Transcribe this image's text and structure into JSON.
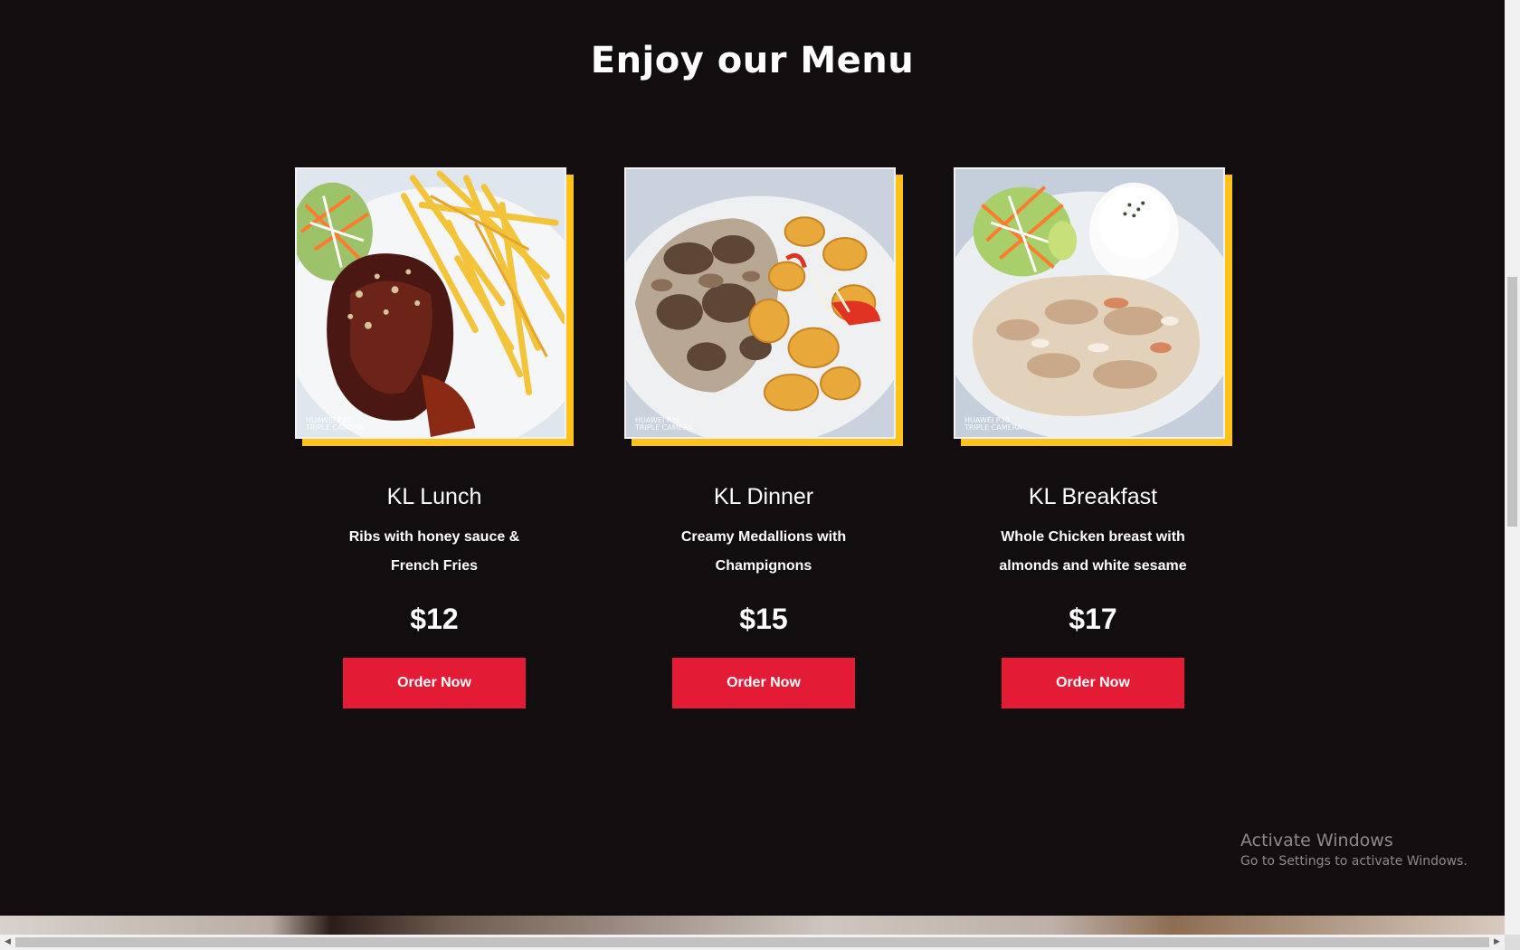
{
  "menu": {
    "title": "Enjoy our Menu",
    "items": [
      {
        "name": "KL Lunch",
        "description": "Ribs with honey sauce & French Fries",
        "price": "$12",
        "button": "Order Now",
        "photo_watermark_line1": "HUAWEI P30",
        "photo_watermark_line2": "TRIPLE CAMERA"
      },
      {
        "name": "KL Dinner",
        "description": "Creamy Medallions with Champignons",
        "price": "$15",
        "button": "Order Now",
        "photo_watermark_line1": "HUAWEI P30",
        "photo_watermark_line2": "TRIPLE CAMERA"
      },
      {
        "name": "KL Breakfast",
        "description": "Whole Chicken breast with almonds and white sesame",
        "price": "$17",
        "button": "Order Now",
        "photo_watermark_line1": "HUAWEI P30",
        "photo_watermark_line2": "TRIPLE CAMERA"
      }
    ]
  },
  "windows_notice": {
    "title": "Activate Windows",
    "subtitle": "Go to Settings to activate Windows."
  },
  "colors": {
    "background": "#120e0f",
    "accent_yellow": "#ffc21a",
    "button_red": "#e31b35"
  },
  "icons": {
    "scroll_left": "scroll-left-arrow-icon",
    "scroll_right": "scroll-right-arrow-icon"
  }
}
